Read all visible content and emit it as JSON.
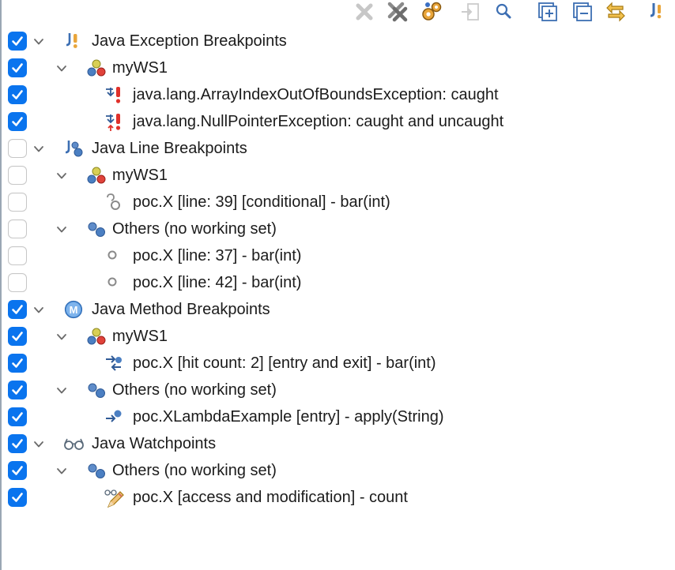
{
  "toolbar": {
    "buttons": [
      {
        "name": "remove-selected-breakpoints-button",
        "icon": "remove-x-icon"
      },
      {
        "name": "remove-all-breakpoints-button",
        "icon": "remove-all-icon"
      },
      {
        "name": "skip-all-breakpoints-button",
        "icon": "skip-breakpoints-icon"
      },
      {
        "name": "go-to-file-button",
        "icon": "go-to-file-icon"
      },
      {
        "name": "show-breakpoints-button",
        "icon": "magnifier-icon"
      },
      {
        "name": "expand-all-button",
        "icon": "expand-all-icon"
      },
      {
        "name": "collapse-all-button",
        "icon": "collapse-all-icon"
      },
      {
        "name": "link-with-debug-view-button",
        "icon": "link-arrows-icon"
      },
      {
        "name": "java-exception-breakpoint-button",
        "icon": "java-exception-icon"
      }
    ]
  },
  "tree": [
    {
      "label": "Java Exception Breakpoints",
      "checked": true,
      "depth": 0,
      "expandable": true,
      "icon": "java-exception-category-icon"
    },
    {
      "label": "myWS1",
      "checked": true,
      "depth": 1,
      "expandable": true,
      "icon": "working-set-red-icon"
    },
    {
      "label": "java.lang.ArrayIndexOutOfBoundsException: caught",
      "checked": true,
      "depth": 2,
      "expandable": false,
      "icon": "exception-breakpoint-icon"
    },
    {
      "label": "java.lang.NullPointerException: caught and uncaught",
      "checked": true,
      "depth": 2,
      "expandable": false,
      "icon": "exception-breakpoint-uncaught-icon"
    },
    {
      "label": "Java Line Breakpoints",
      "checked": false,
      "depth": 0,
      "expandable": true,
      "icon": "java-line-category-icon"
    },
    {
      "label": "myWS1",
      "checked": false,
      "depth": 1,
      "expandable": true,
      "icon": "working-set-red-icon"
    },
    {
      "label": "poc.X [line: 39] [conditional] - bar(int)",
      "checked": false,
      "depth": 2,
      "expandable": false,
      "icon": "conditional-breakpoint-icon"
    },
    {
      "label": "Others (no working set)",
      "checked": false,
      "depth": 1,
      "expandable": true,
      "icon": "working-set-blue-icon"
    },
    {
      "label": "poc.X [line: 37] - bar(int)",
      "checked": false,
      "depth": 2,
      "expandable": false,
      "icon": "line-breakpoint-disabled-icon"
    },
    {
      "label": "poc.X [line: 42] - bar(int)",
      "checked": false,
      "depth": 2,
      "expandable": false,
      "icon": "line-breakpoint-disabled-icon"
    },
    {
      "label": "Java Method Breakpoints",
      "checked": true,
      "depth": 0,
      "expandable": true,
      "icon": "java-method-category-icon"
    },
    {
      "label": "myWS1",
      "checked": true,
      "depth": 1,
      "expandable": true,
      "icon": "working-set-red-icon"
    },
    {
      "label": "poc.X [hit count: 2] [entry and exit] - bar(int)",
      "checked": true,
      "depth": 2,
      "expandable": false,
      "icon": "method-entry-exit-icon"
    },
    {
      "label": "Others (no working set)",
      "checked": true,
      "depth": 1,
      "expandable": true,
      "icon": "working-set-blue-icon"
    },
    {
      "label": "poc.XLambdaExample [entry] - apply(String)",
      "checked": true,
      "depth": 2,
      "expandable": false,
      "icon": "method-entry-icon"
    },
    {
      "label": "Java Watchpoints",
      "checked": true,
      "depth": 0,
      "expandable": true,
      "icon": "watchpoint-glasses-icon"
    },
    {
      "label": "Others (no working set)",
      "checked": true,
      "depth": 1,
      "expandable": true,
      "icon": "working-set-blue-icon"
    },
    {
      "label": "poc.X [access and modification] - count",
      "checked": true,
      "depth": 2,
      "expandable": false,
      "icon": "watchpoint-edit-icon"
    }
  ]
}
